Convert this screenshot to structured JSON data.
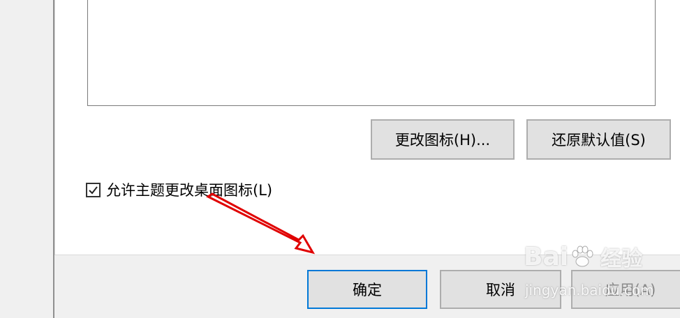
{
  "buttons": {
    "change_icon": "更改图标(H)...",
    "restore_default": "还原默认值(S)",
    "ok": "确定",
    "cancel": "取消",
    "apply": "应用(A)"
  },
  "checkbox": {
    "label": "允许主题更改桌面图标(L)",
    "checked": true
  },
  "watermark": {
    "logo_left": "Bai",
    "logo_right": "经验",
    "url": "jingyan.baidu.com"
  },
  "colors": {
    "focus_border": "#0078d7",
    "annotation_arrow": "#e00000"
  }
}
